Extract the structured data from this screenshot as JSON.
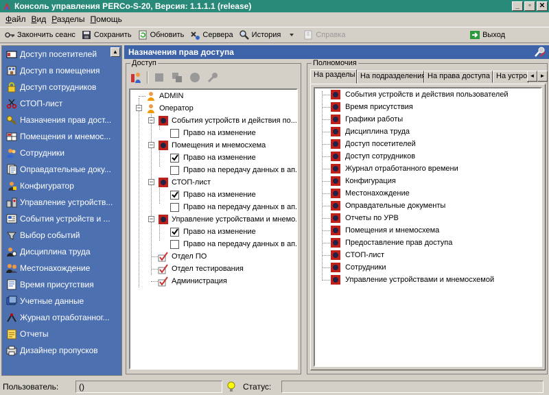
{
  "window": {
    "title": "Консоль управления PERCo-S-20, Версия: 1.1.1.1 (release)",
    "minimize": "_",
    "maximize": "▫",
    "close": "✕"
  },
  "menu": [
    {
      "label": "Файл",
      "key": "Ф",
      "rest": "айл"
    },
    {
      "label": "Вид",
      "key": "В",
      "rest": "ид"
    },
    {
      "label": "Разделы",
      "key": "Р",
      "rest": "азделы"
    },
    {
      "label": "Помощь",
      "key": "П",
      "rest": "омощь"
    }
  ],
  "toolbar": {
    "end_session": "Закончить сеанс",
    "save": "Сохранить",
    "refresh": "Обновить",
    "servers": "Сервера",
    "history": "История",
    "help": "Справка",
    "exit": "Выход"
  },
  "sidebar": {
    "items": [
      {
        "label": "Доступ посетителей",
        "icon": "card-icon"
      },
      {
        "label": "Доступ в помещения",
        "icon": "building-icon"
      },
      {
        "label": "Доступ сотрудников",
        "icon": "lock-icon"
      },
      {
        "label": "СТОП-лист",
        "icon": "scissors-icon"
      },
      {
        "label": "Назначения прав дост...",
        "icon": "key-icon"
      },
      {
        "label": "Помещения и мнемос...",
        "icon": "rooms-icon"
      },
      {
        "label": "Сотрудники",
        "icon": "people-icon"
      },
      {
        "label": "Оправдательные доку...",
        "icon": "documents-icon"
      },
      {
        "label": "Конфигуратор",
        "icon": "configurator-icon"
      },
      {
        "label": "Управление устройств...",
        "icon": "devices-icon"
      },
      {
        "label": "События устройств и ...",
        "icon": "events-icon"
      },
      {
        "label": "Выбор событий",
        "icon": "select-events-icon"
      },
      {
        "label": "Дисциплина труда",
        "icon": "discipline-icon"
      },
      {
        "label": "Местонахождение",
        "icon": "location-icon"
      },
      {
        "label": "Время присутствия",
        "icon": "time-icon"
      },
      {
        "label": "Учетные данные",
        "icon": "accounts-icon"
      },
      {
        "label": "Журнал отработанног...",
        "icon": "journal-icon"
      },
      {
        "label": "Отчеты",
        "icon": "reports-icon"
      },
      {
        "label": "Дизайнер пропусков",
        "icon": "designer-icon"
      }
    ]
  },
  "panel": {
    "title": "Назначения прав доступа"
  },
  "access_group": {
    "label": "Доступ",
    "tree": [
      {
        "text": "ADMIN",
        "type": "user"
      },
      {
        "text": "Оператор",
        "type": "user"
      },
      {
        "text": "События устройств и действия по...",
        "type": "section"
      },
      {
        "text": "Право на изменение",
        "type": "check",
        "checked": false
      },
      {
        "text": "Помещения и мнемосхема",
        "type": "section"
      },
      {
        "text": "Право на изменение",
        "type": "check",
        "checked": true
      },
      {
        "text": "Право на передачу данных в ап...",
        "type": "check",
        "checked": false
      },
      {
        "text": "СТОП-лист",
        "type": "section"
      },
      {
        "text": "Право на изменение",
        "type": "check",
        "checked": true
      },
      {
        "text": "Право на передачу данных в ап...",
        "type": "check",
        "checked": false
      },
      {
        "text": "Управление устройствами и мнемо...",
        "type": "section"
      },
      {
        "text": "Право на изменение",
        "type": "check",
        "checked": true
      },
      {
        "text": "Право на передачу данных в ап...",
        "type": "check",
        "checked": false
      },
      {
        "text": "Отдел ПО",
        "type": "dept"
      },
      {
        "text": "Отдел тестирования",
        "type": "dept"
      },
      {
        "text": "Администрация",
        "type": "dept"
      }
    ]
  },
  "permissions_group": {
    "label": "Полномочия",
    "tabs": [
      "На разделы",
      "На подразделения",
      "На права доступа",
      "На устрой"
    ],
    "nav_prev": "◄",
    "nav_next": "►",
    "items": [
      "События устройств и действия пользователей",
      "Время присутствия",
      "Графики работы",
      "Дисциплина труда",
      "Доступ посетителей",
      "Доступ сотрудников",
      "Журнал отработанного времени",
      "Конфигурация",
      "Местонахождение",
      "Оправдательные документы",
      "Отчеты по УРВ",
      "Помещения и мнемосхема",
      "Предоставление прав доступа",
      "СТОП-лист",
      "Сотрудники",
      "Управление устройствами и мнемосхемой"
    ]
  },
  "status": {
    "user_label": "Пользователь:",
    "user_value": "()",
    "status_label": "Статус:",
    "status_value": ""
  },
  "colors": {
    "title_bar": "#2a8a7a",
    "sidebar": "#4d70b0",
    "panel_header": "#3d64a8",
    "section_icon": "#c0201a"
  }
}
